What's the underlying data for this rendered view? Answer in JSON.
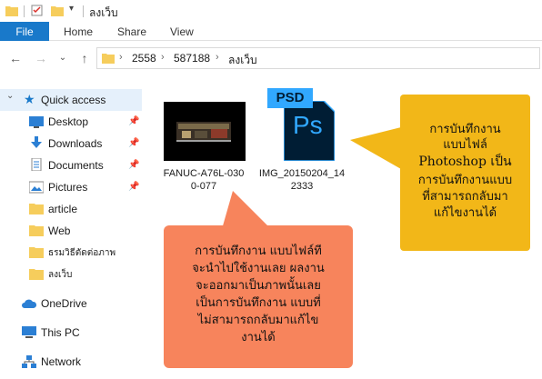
{
  "window": {
    "title": "ลงเว็บ"
  },
  "ribbon": {
    "tabs": [
      "File",
      "Home",
      "Share",
      "View"
    ]
  },
  "address": {
    "parts": [
      "2558",
      "587188",
      "ลงเว็บ"
    ]
  },
  "sidebar": {
    "quick_access": "Quick access",
    "items": [
      {
        "label": "Desktop",
        "pinned": true
      },
      {
        "label": "Downloads",
        "pinned": true
      },
      {
        "label": "Documents",
        "pinned": true
      },
      {
        "label": "Pictures",
        "pinned": true
      },
      {
        "label": "article"
      },
      {
        "label": "Web"
      },
      {
        "label": "ธรมวิธีตัดต่อภาพ"
      },
      {
        "label": "ลงเว็บ"
      }
    ],
    "onedrive": "OneDrive",
    "thispc": "This PC",
    "network": "Network"
  },
  "files": [
    {
      "name_line1": "FANUC-A76L-030",
      "name_line2": "0-077"
    },
    {
      "icon_text": "PSD",
      "ps_text": "Ps",
      "name_line1": "IMG_20150204_14",
      "name_line2": "2333"
    }
  ],
  "callouts": {
    "yellow": [
      "การบันทึกงาน",
      "แบบไฟล์",
      "Photoshop เป็น",
      "การบันทึกงานแบบ",
      "ที่สามารถกลับมา",
      "แก้ไขงานได้"
    ],
    "orange": [
      "การบันทึกงาน แบบไฟล์ที",
      "จะนำไปใช้งานเลย ผลงาน",
      "จะออกมาเป็นภาพนั้นเลย",
      "เป็นการบันทึกงาน แบบที่",
      "ไม่สามารถกลับมาแก้ไข",
      "งานได้"
    ]
  },
  "colors": {
    "accent": "#1979ca",
    "yellow": "#f2b718",
    "orange": "#f7845c",
    "folder": "#f6cd5c"
  }
}
